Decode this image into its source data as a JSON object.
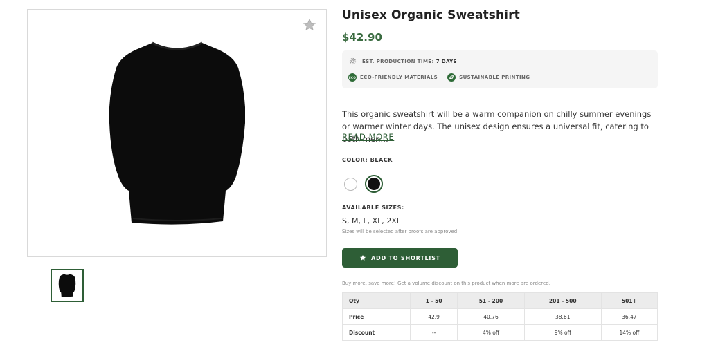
{
  "product": {
    "title": "Unisex Organic Sweatshirt",
    "price": "$42.90",
    "description": "This organic sweatshirt will be a warm companion on chilly summer evenings or warmer winter days. The unisex design ensures a universal fit, catering to both men…",
    "read_more": "READ MORE"
  },
  "info": {
    "production_label": "EST. PRODUCTION TIME:",
    "production_value": "7 DAYS",
    "eco_badge_text": "ECO",
    "eco_label": "ECO-FRIENDLY MATERIALS",
    "printing_label": "SUSTAINABLE PRINTING"
  },
  "color": {
    "label": "COLOR: BLACK",
    "options": [
      "white",
      "black"
    ],
    "selected": "black",
    "swatch_colors": {
      "white": "#ffffff",
      "black": "#111111"
    }
  },
  "sizes": {
    "label": "AVAILABLE SIZES:",
    "values": "S, M, L, XL, 2XL",
    "note": "Sizes will be selected after proofs are approved"
  },
  "actions": {
    "add_shortlist": "ADD TO SHORTLIST"
  },
  "bulk": {
    "note": "Buy more, save more! Get a volume discount on this product when more are ordered.",
    "headers": [
      "Qty",
      "1 - 50",
      "51 - 200",
      "201 - 500",
      "501+"
    ],
    "rows": [
      [
        "Price",
        "42.9",
        "40.76",
        "38.61",
        "36.47"
      ],
      [
        "Discount",
        "--",
        "4% off",
        "9% off",
        "14% off"
      ]
    ]
  },
  "icons": {
    "favorite": "star-icon",
    "production": "gear-icon",
    "eco": "eco-icon",
    "printing": "leaf-icon",
    "shortlist": "star-icon"
  },
  "colors": {
    "accent": "#2e5e36",
    "price": "#3a6b40",
    "info_bg": "#f5f5f5"
  }
}
